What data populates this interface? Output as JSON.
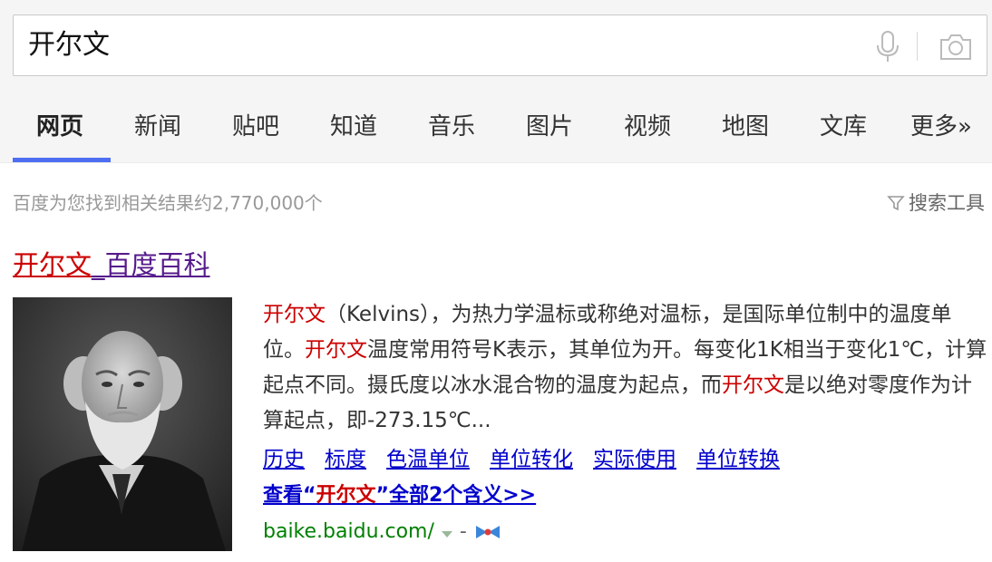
{
  "search": {
    "query": "开尔文"
  },
  "tabs": [
    {
      "label": "网页",
      "active": true
    },
    {
      "label": "新闻"
    },
    {
      "label": "贴吧"
    },
    {
      "label": "知道"
    },
    {
      "label": "音乐"
    },
    {
      "label": "图片"
    },
    {
      "label": "视频"
    },
    {
      "label": "地图"
    },
    {
      "label": "文库"
    },
    {
      "label": "更多»"
    }
  ],
  "meta": {
    "result_count": "百度为您找到相关结果约2,770,000个",
    "tools_label": "搜索工具"
  },
  "result": {
    "title_hl": "开尔文",
    "title_rest": "_百度百科",
    "abstract": [
      {
        "t": "开尔文",
        "hl": true
      },
      {
        "t": "（Kelvins），为热力学温标或称绝对温标，是国际单位制中的温度单位。"
      },
      {
        "t": "开尔文",
        "hl": true
      },
      {
        "t": "温度常用符号K表示，其单位为开。每变化1K相当于变化1℃，计算起点不同。摄氏度以冰水混合物的温度为起点，而"
      },
      {
        "t": "开尔文",
        "hl": true
      },
      {
        "t": "是以绝对零度作为计算起点，即-273.15℃..."
      }
    ],
    "links": [
      "历史",
      "标度",
      "色温单位",
      "单位转化",
      "实际使用",
      "单位转换"
    ],
    "see_all": {
      "pre": "查看“",
      "hl": "开尔文",
      "post": "”全部2个含义>>"
    },
    "url": "baike.baidu.com/",
    "url_dash": "-"
  },
  "colors": {
    "accent": "#4e6ef2",
    "highlight": "#cc0000",
    "link": "#0000cc",
    "url": "#008000"
  }
}
